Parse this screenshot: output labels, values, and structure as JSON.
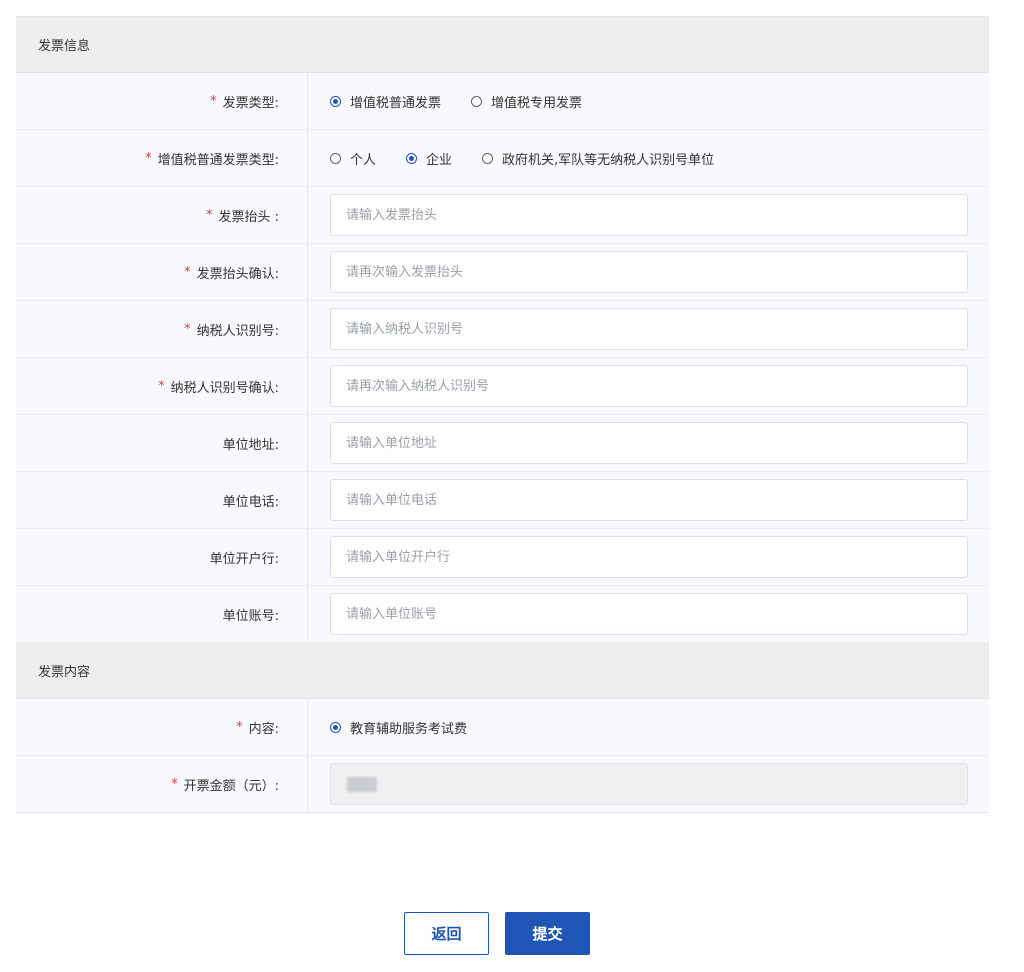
{
  "invoice_info": {
    "section_title": "发票信息",
    "invoice_type": {
      "label": "发票类型:",
      "options": [
        "增值税普通发票",
        "增值税专用发票"
      ],
      "selected": "增值税普通发票"
    },
    "vat_normal_type": {
      "label": "增值税普通发票类型:",
      "options": [
        "个人",
        "企业",
        "政府机关,军队等无纳税人识别号单位"
      ],
      "selected": "企业"
    },
    "fields": [
      {
        "label": "发票抬头 :",
        "required": true,
        "placeholder": "请输入发票抬头",
        "value": ""
      },
      {
        "label": "发票抬头确认:",
        "required": true,
        "placeholder": "请再次输入发票抬头",
        "value": ""
      },
      {
        "label": "纳税人识别号:",
        "required": true,
        "placeholder": "请输入纳税人识别号",
        "value": ""
      },
      {
        "label": "纳税人识别号确认:",
        "required": true,
        "placeholder": "请再次输入纳税人识别号",
        "value": ""
      },
      {
        "label": "单位地址:",
        "required": false,
        "placeholder": "请输入单位地址",
        "value": ""
      },
      {
        "label": "单位电话:",
        "required": false,
        "placeholder": "请输入单位电话",
        "value": ""
      },
      {
        "label": "单位开户行:",
        "required": false,
        "placeholder": "请输入单位开户行",
        "value": ""
      },
      {
        "label": "单位账号:",
        "required": false,
        "placeholder": "请输入单位账号",
        "value": ""
      }
    ]
  },
  "invoice_content": {
    "section_title": "发票内容",
    "content": {
      "label": "内容:",
      "options": [
        "教育辅助服务考试费"
      ],
      "selected": "教育辅助服务考试费"
    },
    "amount": {
      "label": "开票金额（元）:"
    }
  },
  "required_mark": "*",
  "buttons": {
    "back": "返回",
    "submit": "提交"
  },
  "colors": {
    "primary": "#1f55b5",
    "required": "#e93a3a",
    "section_bg": "#eeeeee",
    "row_bg": "#f7f9fc"
  }
}
